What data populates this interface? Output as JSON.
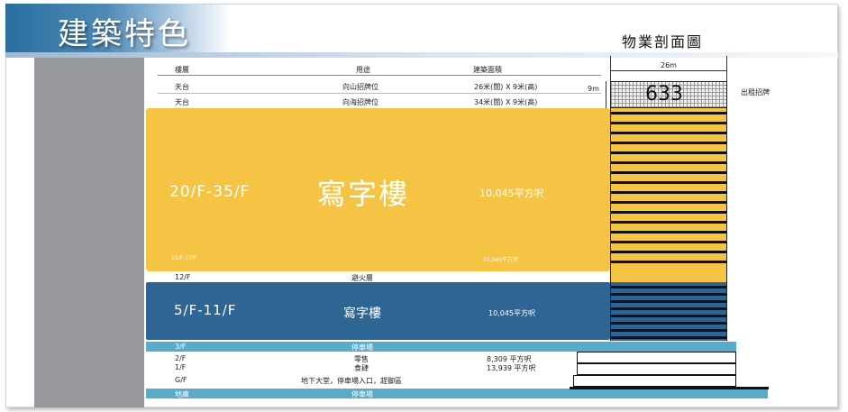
{
  "header": {
    "title": "建築特色",
    "section_title": "物業剖面圖"
  },
  "table_header": {
    "col_floor": "樓層",
    "col_use": "用途",
    "col_area": "建築面積"
  },
  "roof_rows": [
    {
      "floor": "天台",
      "use": "向山招牌位",
      "area": "26米(闊) X 9米(高)"
    },
    {
      "floor": "天台",
      "use": "向海招牌位",
      "area": "34米(闊) X 9米(高)"
    }
  ],
  "office_high": {
    "floors": "20/F-35/F",
    "use": "寫字樓",
    "area": "10,045平方呎",
    "sub_floors": "15/F-17/F",
    "sub_area": "10,045平方呎"
  },
  "refuge": {
    "floor": "12/F",
    "use": "避火層"
  },
  "office_low": {
    "floors": "5/F-11/F",
    "use": "寫字樓",
    "area": "10,045平方呎"
  },
  "carpark_3f": {
    "floor": "3/F",
    "use": "停車場"
  },
  "lower_rows": [
    {
      "floor": "2/F",
      "use": "零售",
      "area": "8,309 平方呎"
    },
    {
      "floor": "1/F",
      "use": "食肆",
      "area": "13,939 平方呎"
    },
    {
      "floor": "G/F",
      "use": "地下大堂，停車場入口，趕御區",
      "area": ""
    }
  ],
  "basement": {
    "floor": "地庫",
    "use": "停車場"
  },
  "diagram": {
    "width_label": "26m",
    "height_label": "9m",
    "sign_number": "633",
    "sign_label": "出租招牌"
  },
  "colors": {
    "yellow": "#f6c444",
    "dark_blue": "#2e6594",
    "light_blue": "#5aaac9",
    "left_bar": "#98999c"
  }
}
